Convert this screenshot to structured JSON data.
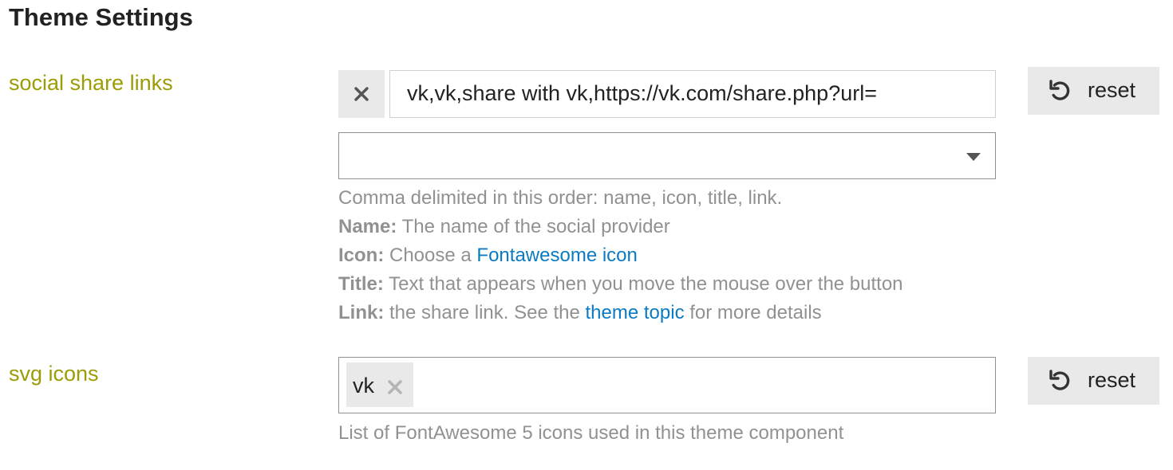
{
  "page": {
    "title": "Theme Settings"
  },
  "social_share": {
    "label": "social share links",
    "value": "vk,vk,share with vk,https://vk.com/share.php?url=",
    "dropdown_value": "",
    "help": {
      "intro": "Comma delimited in this order: name, icon, title, link.",
      "name_key": "Name:",
      "name_text": "The name of the social provider",
      "icon_key": "Icon:",
      "icon_text": "Choose a",
      "icon_link": "Fontawesome icon",
      "title_key": "Title:",
      "title_text": "Text that appears when you move the mouse over the button",
      "link_key": "Link:",
      "link_text_before": "the share link. See the",
      "link_link": "theme topic",
      "link_text_after": "for more details"
    },
    "reset_label": "reset"
  },
  "svg_icons": {
    "label": "svg icons",
    "chips": [
      "vk"
    ],
    "help": "List of FontAwesome 5 icons used in this theme component",
    "reset_label": "reset"
  },
  "colors": {
    "label": "#9c9c05",
    "link": "#0a7bc2",
    "help_text": "#919191",
    "button_bg": "#e9e9e9"
  },
  "icons": {
    "clear": "close-icon",
    "reset": "undo-icon",
    "dropdown": "caret-down-icon",
    "chip_remove": "close-icon"
  }
}
